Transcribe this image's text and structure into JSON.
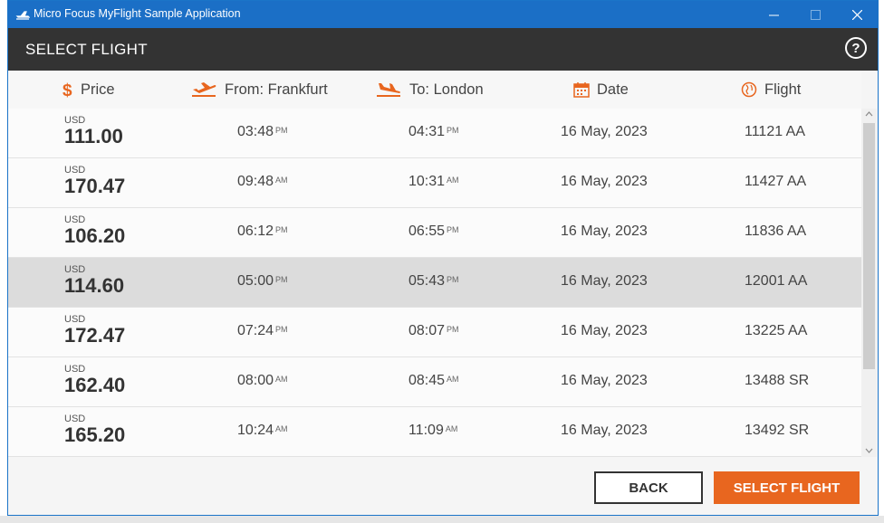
{
  "window": {
    "title": "Micro Focus MyFlight Sample Application"
  },
  "header": {
    "title": "SELECT FLIGHT",
    "help_label": "?"
  },
  "columns": {
    "price": "Price",
    "from": "From: Frankfurt",
    "to": "To: London",
    "date": "Date",
    "flight": "Flight"
  },
  "flights": [
    {
      "currency": "USD",
      "price": "111.00",
      "dep_time": "03:48",
      "dep_ampm": "PM",
      "arr_time": "04:31",
      "arr_ampm": "PM",
      "date": "16 May, 2023",
      "flight": "11121 AA"
    },
    {
      "currency": "USD",
      "price": "170.47",
      "dep_time": "09:48",
      "dep_ampm": "AM",
      "arr_time": "10:31",
      "arr_ampm": "AM",
      "date": "16 May, 2023",
      "flight": "11427 AA"
    },
    {
      "currency": "USD",
      "price": "106.20",
      "dep_time": "06:12",
      "dep_ampm": "PM",
      "arr_time": "06:55",
      "arr_ampm": "PM",
      "date": "16 May, 2023",
      "flight": "11836 AA"
    },
    {
      "currency": "USD",
      "price": "114.60",
      "dep_time": "05:00",
      "dep_ampm": "PM",
      "arr_time": "05:43",
      "arr_ampm": "PM",
      "date": "16 May, 2023",
      "flight": "12001 AA",
      "selected": true
    },
    {
      "currency": "USD",
      "price": "172.47",
      "dep_time": "07:24",
      "dep_ampm": "PM",
      "arr_time": "08:07",
      "arr_ampm": "PM",
      "date": "16 May, 2023",
      "flight": "13225 AA"
    },
    {
      "currency": "USD",
      "price": "162.40",
      "dep_time": "08:00",
      "dep_ampm": "AM",
      "arr_time": "08:45",
      "arr_ampm": "AM",
      "date": "16 May, 2023",
      "flight": "13488 SR"
    },
    {
      "currency": "USD",
      "price": "165.20",
      "dep_time": "10:24",
      "dep_ampm": "AM",
      "arr_time": "11:09",
      "arr_ampm": "AM",
      "date": "16 May, 2023",
      "flight": "13492 SR"
    }
  ],
  "footer": {
    "back_label": "BACK",
    "select_label": "SELECT FLIGHT"
  },
  "colors": {
    "accent": "#e8661f",
    "titlebar": "#1b6fc6",
    "header": "#333333",
    "selected_row": "#dcdcdc"
  },
  "icons": {
    "price": "dollar-icon",
    "from": "plane-takeoff-icon",
    "to": "plane-landing-icon",
    "date": "calendar-icon",
    "flight": "globe-icon"
  }
}
